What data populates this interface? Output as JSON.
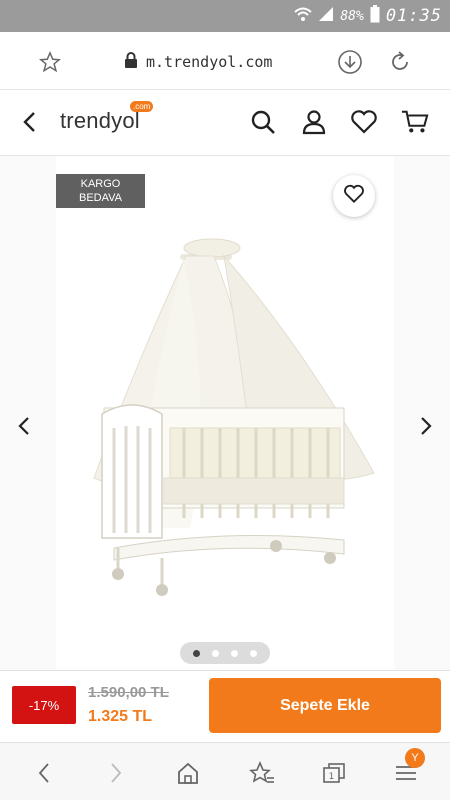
{
  "status_bar": {
    "battery_pct": "88%",
    "time": "01:35",
    "icons": [
      "wifi-icon",
      "signal-icon",
      "battery-icon"
    ]
  },
  "browser": {
    "url": "m.trendyol.com",
    "icons": [
      "star-icon",
      "lock-icon",
      "download-icon",
      "refresh-icon"
    ]
  },
  "site_header": {
    "logo": "trendyol",
    "logo_badge": ".com",
    "icons": [
      "back-icon",
      "search-icon",
      "user-icon",
      "heart-icon",
      "cart-icon"
    ]
  },
  "product": {
    "badge_line1": "KARGO",
    "badge_line2": "BEDAVA",
    "image_total": 4,
    "image_active_index": 0
  },
  "buy_bar": {
    "discount": "-17%",
    "old_price": "1.590,00 TL",
    "new_price": "1.325 TL",
    "add_to_cart": "Sepete Ekle"
  },
  "bottom_nav": {
    "menu_badge": "Y",
    "icons": [
      "back-nav-icon",
      "forward-nav-icon",
      "home-icon",
      "bookmark-star-icon",
      "tabs-icon",
      "menu-icon"
    ]
  },
  "colors": {
    "accent": "#f27a1a",
    "discount": "#d21312",
    "status_bar": "#9b9b9b"
  }
}
